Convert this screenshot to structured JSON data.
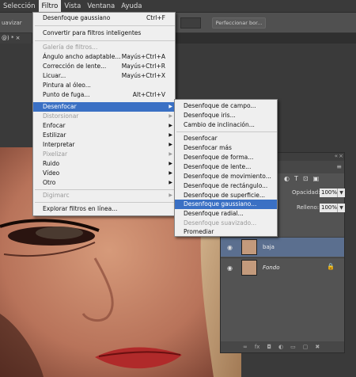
{
  "menubar": {
    "items": [
      "Selección",
      "Filtro",
      "Vista",
      "Ventana",
      "Ayuda"
    ]
  },
  "optionsbar": {
    "left_label": "uavizar",
    "refine_button": "Perfeccionar bor..."
  },
  "document": {
    "tab_label": "@) * ×"
  },
  "filter_menu": {
    "items": [
      {
        "label": "Desenfoque gaussiano",
        "shortcut": "Ctrl+F",
        "disabled": false
      },
      {
        "label": "Convertir para filtros inteligentes",
        "disabled": false
      },
      {
        "label": "Galería de filtros...",
        "disabled": true
      },
      {
        "label": "Ángulo ancho adaptable...",
        "shortcut": "Mayús+Ctrl+A",
        "disabled": false
      },
      {
        "label": "Corrección de lente...",
        "shortcut": "Mayús+Ctrl+R",
        "disabled": false
      },
      {
        "label": "Licuar...",
        "shortcut": "Mayús+Ctrl+X",
        "disabled": false
      },
      {
        "label": "Pintura al óleo...",
        "disabled": false
      },
      {
        "label": "Punto de fuga...",
        "shortcut": "Alt+Ctrl+V",
        "disabled": false
      },
      {
        "label": "Desenfocar",
        "submenu": true,
        "highlighted": true
      },
      {
        "label": "Distorsionar",
        "submenu": true,
        "disabled": true
      },
      {
        "label": "Enfocar",
        "submenu": true
      },
      {
        "label": "Estilizar",
        "submenu": true
      },
      {
        "label": "Interpretar",
        "submenu": true
      },
      {
        "label": "Pixelizar",
        "submenu": true,
        "disabled": true
      },
      {
        "label": "Ruido",
        "submenu": true
      },
      {
        "label": "Vídeo",
        "submenu": true
      },
      {
        "label": "Otro",
        "submenu": true
      },
      {
        "label": "Digimarc",
        "submenu": true,
        "disabled": true
      },
      {
        "label": "Explorar filtros en línea..."
      }
    ]
  },
  "blur_submenu": {
    "items": [
      {
        "label": "Desenfoque de campo..."
      },
      {
        "label": "Desenfoque iris..."
      },
      {
        "label": "Cambio de inclinación..."
      },
      {
        "label": "Desenfocar"
      },
      {
        "label": "Desenfocar más"
      },
      {
        "label": "Desenfoque de forma..."
      },
      {
        "label": "Desenfoque de lente..."
      },
      {
        "label": "Desenfoque de movimiento..."
      },
      {
        "label": "Desenfoque de rectángulo..."
      },
      {
        "label": "Desenfoque de superficie..."
      },
      {
        "label": "Desenfoque gaussiano...",
        "highlighted": true
      },
      {
        "label": "Desenfoque radial..."
      },
      {
        "label": "Desenfoque suavizado...",
        "disabled": true
      },
      {
        "label": "Promediar"
      }
    ]
  },
  "layers_panel": {
    "opacity_label": "Opacidad:",
    "opacity_value": "100%",
    "fill_label": "Relleno:",
    "fill_value": "100%",
    "layers": [
      {
        "name": "baja",
        "selected": true
      },
      {
        "name": "Fondo",
        "locked": true
      }
    ]
  },
  "colors": {
    "menu_highlight": "#3a70c4",
    "layer_selected": "#5b6f8f"
  }
}
